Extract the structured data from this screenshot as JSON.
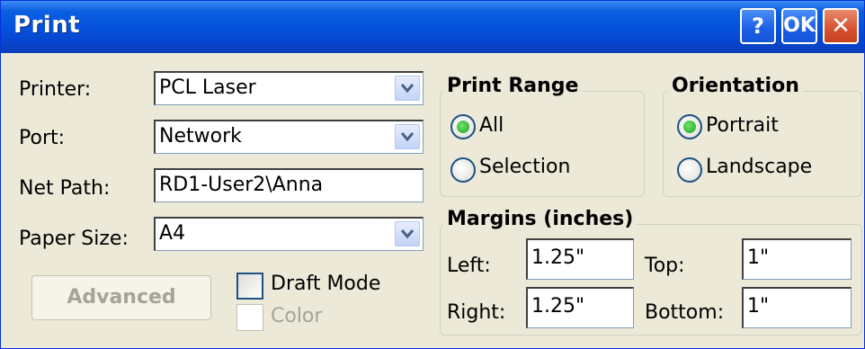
{
  "window": {
    "title": "Print",
    "help_label": "?",
    "ok_label": "OK",
    "close_label": "✕"
  },
  "printer": {
    "label": "Printer:",
    "value": "PCL Laser"
  },
  "port": {
    "label": "Port:",
    "value": "Network"
  },
  "net_path": {
    "label": "Net Path:",
    "value": "RD1-User2\\Anna"
  },
  "paper_size": {
    "label": "Paper Size:",
    "value": "A4"
  },
  "advanced_label": "Advanced",
  "draft_mode": {
    "label": "Draft Mode",
    "checked": false
  },
  "color": {
    "label": "Color",
    "checked": false,
    "disabled": true
  },
  "print_range": {
    "title": "Print Range",
    "options": [
      {
        "label": "All",
        "selected": true
      },
      {
        "label": "Selection",
        "selected": false
      }
    ]
  },
  "orientation": {
    "title": "Orientation",
    "options": [
      {
        "label": "Portrait",
        "selected": true
      },
      {
        "label": "Landscape",
        "selected": false
      }
    ]
  },
  "margins": {
    "title": "Margins (inches)",
    "left": {
      "label": "Left:",
      "value": "1.25\""
    },
    "right": {
      "label": "Right:",
      "value": "1.25\""
    },
    "top": {
      "label": "Top:",
      "value": "1\""
    },
    "bottom": {
      "label": "Bottom:",
      "value": "1\""
    }
  },
  "colors": {
    "titlebar": "#0550dc",
    "dialog_bg": "#ece9d8",
    "radio_selected": "#21a121",
    "close_button": "#d8502d"
  }
}
